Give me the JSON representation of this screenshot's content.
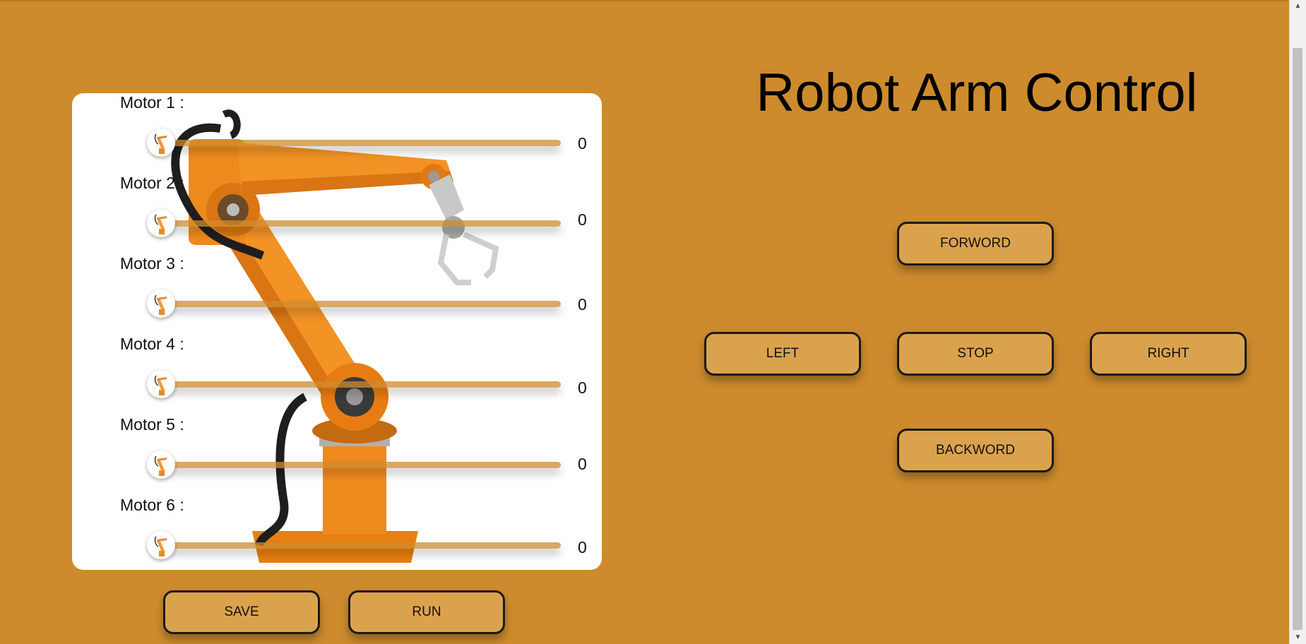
{
  "title": "Robot Arm Control",
  "motors": [
    {
      "label": "Motor 1 :",
      "value": "0"
    },
    {
      "label": "Motor 2 :",
      "value": "0"
    },
    {
      "label": "Motor 3 :",
      "value": "0"
    },
    {
      "label": "Motor 4 :",
      "value": "0"
    },
    {
      "label": "Motor 5 :",
      "value": "0"
    },
    {
      "label": "Motor 6 :",
      "value": "0"
    }
  ],
  "buttons": {
    "save": "SAVE",
    "run": "RUN",
    "forward": "FORWORD",
    "left": "LEFT",
    "stop": "STOP",
    "right": "RIGHT",
    "backward": "BACKWORD"
  },
  "colors": {
    "background": "#cd8b2d",
    "button": "#dba24e",
    "panel": "#ffffff",
    "robot": "#f08a1c"
  },
  "icons": {
    "slider_thumb": "robot-arm-icon",
    "panel_background": "robot-arm-illustration"
  }
}
